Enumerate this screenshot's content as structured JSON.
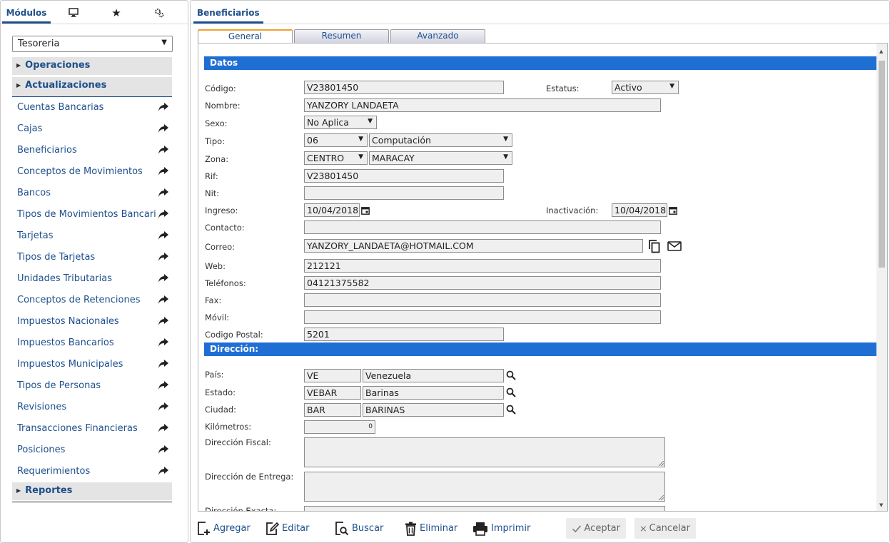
{
  "left": {
    "tabs": {
      "modulos": "Módulos"
    },
    "module_select": "Tesoreria",
    "sections": {
      "operaciones": "Operaciones",
      "actualizaciones": "Actualizaciones",
      "reportes": "Reportes"
    },
    "menu": [
      "Cuentas Bancarias",
      "Cajas",
      "Beneficiarios",
      "Conceptos de Movimientos",
      "Bancos",
      "Tipos de Movimientos Bancarios",
      "Tarjetas",
      "Tipos de Tarjetas",
      "Unidades Tributarias",
      "Conceptos de Retenciones",
      "Impuestos Nacionales",
      "Impuestos Bancarios",
      "Impuestos Municipales",
      "Tipos de Personas",
      "Revisiones",
      "Transacciones Financieras",
      "Posiciones",
      "Requerimientos"
    ]
  },
  "main": {
    "tab": "Beneficiarios",
    "subtabs": {
      "general": "General",
      "resumen": "Resumen",
      "avanzado": "Avanzado"
    },
    "sections": {
      "datos": "Datos",
      "direccion": "Dirección:"
    },
    "labels": {
      "codigo": "Código:",
      "estatus": "Estatus:",
      "nombre": "Nombre:",
      "sexo": "Sexo:",
      "tipo": "Tipo:",
      "zona": "Zona:",
      "rif": "Rif:",
      "nit": "Nit:",
      "ingreso": "Ingreso:",
      "inactivacion": "Inactivación:",
      "contacto": "Contacto:",
      "correo": "Correo:",
      "web": "Web:",
      "telefonos": "Teléfonos:",
      "fax": "Fax:",
      "movil": "Móvil:",
      "codigo_postal": "Codigo Postal:",
      "pais": "País:",
      "estado": "Estado:",
      "ciudad": "Ciudad:",
      "kilometros": "Kilómetros:",
      "direccion_fiscal": "Dirección Fiscal:",
      "direccion_entrega": "Dirección de Entrega:",
      "direccion_exacta": "Dirección Exacta:"
    },
    "values": {
      "codigo": "V23801450",
      "estatus": "Activo",
      "nombre": "YANZORY LANDAETA",
      "sexo": "No Aplica",
      "tipo_code": "06",
      "tipo_desc": "Computación",
      "zona_code": "CENTRO",
      "zona_desc": "MARACAY",
      "rif": "V23801450",
      "nit": "",
      "ingreso": "10/04/2018",
      "inactivacion": "10/04/2018",
      "contacto": "",
      "correo": "YANZORY_LANDAETA@HOTMAIL.COM",
      "web": "212121",
      "telefonos": "04121375582",
      "fax": "",
      "movil": "",
      "codigo_postal": "5201",
      "pais_code": "VE",
      "pais_name": "Venezuela",
      "estado_code": "VEBAR",
      "estado_name": "Barinas",
      "ciudad_code": "BAR",
      "ciudad_name": "BARINAS",
      "kilometros": "0",
      "direccion_fiscal": "",
      "direccion_entrega": "",
      "direccion_exacta": ""
    }
  },
  "toolbar": {
    "agregar": "Agregar",
    "editar": "Editar",
    "buscar": "Buscar",
    "eliminar": "Eliminar",
    "imprimir": "Imprimir",
    "aceptar": "Aceptar",
    "cancelar": "Cancelar"
  },
  "icons": [
    "monitor-icon",
    "star-icon",
    "settings-icon",
    "share-arrow-icon",
    "calendar-icon",
    "copy-icon",
    "mail-icon",
    "search-icon"
  ],
  "colors": {
    "accent": "#1e4f8c",
    "band": "#1f6ed4",
    "active_tab": "#f0a030"
  }
}
